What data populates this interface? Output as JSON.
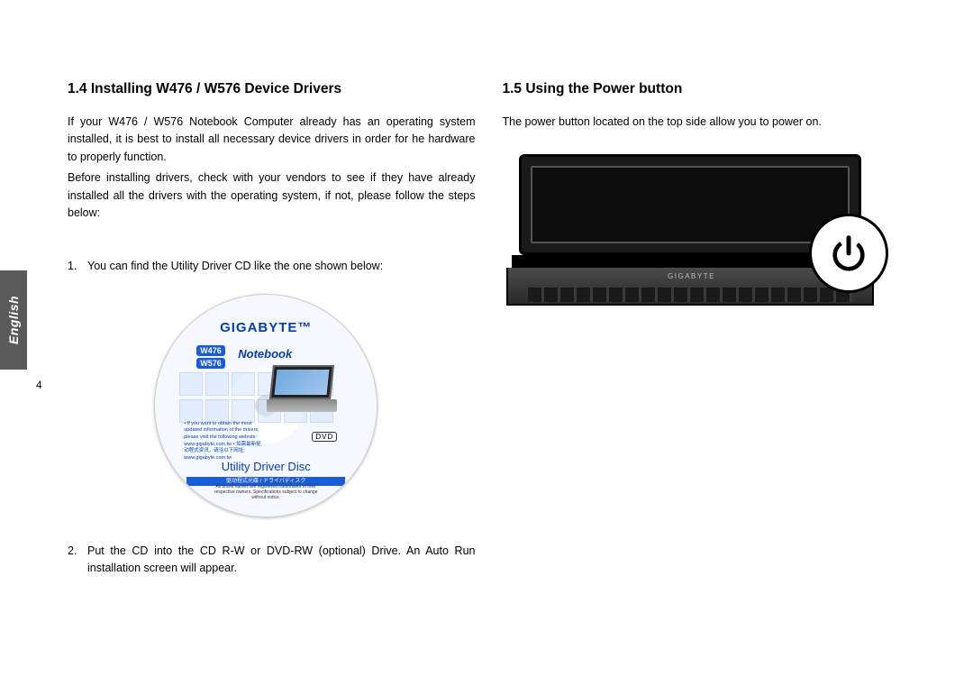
{
  "language_tab": "English",
  "page_number": "4",
  "left": {
    "heading": "1.4  Installing W476 / W576 Device Drivers",
    "para1": "If your W476 / W576 Notebook Computer already has an operating system installed, it is best to install all necessary device drivers in order for he hardware to properly function.",
    "para2": "Before installing drivers, check with your vendors to see if they have already installed all the drivers with the operating system, if not, please follow the steps below:",
    "step1_num": "1.",
    "step1": "You can find the Utility Driver CD like the one shown below:",
    "step2_num": "2.",
    "step2": "Put the CD into the CD R-W or DVD-RW (optional) Drive. An Auto Run installation screen will appear.",
    "cd": {
      "brand": "GIGABYTE™",
      "badge1": "W476",
      "badge2": "W576",
      "notebook": "Notebook",
      "utility": "Utility Driver Disc",
      "strip": "驱动程式光碟 / ドライバディスク",
      "dvd": "DVD",
      "info_bullets": "• If you want to obtain the most updated information of the drivers, please visit the following website: www.gigabyte.com.tw\n• 如需最新驱动程式资讯，请洽以下网址: www.gigabyte.com.tw",
      "fine": "All brand names are registered trademarks of their respective owners. Specifications subject to change without notice."
    }
  },
  "right": {
    "heading": "1.5  Using the Power button",
    "para1": "The power button located on the top side allow you to power on.",
    "laptop_brand": "GIGABYTE"
  }
}
